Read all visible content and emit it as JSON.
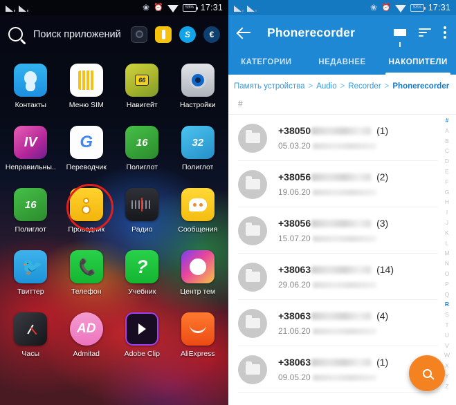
{
  "left_panel": {
    "status_bar": {
      "signal_1": "signal-bars-icon",
      "signal_2": "signal-bars-icon",
      "bluetooth": "bluetooth-icon",
      "alarm": "alarm-clock-icon",
      "wifi": "wifi-icon",
      "battery_label": "53%",
      "time": "17:31"
    },
    "search": {
      "icon": "search-icon",
      "placeholder": "Поиск приложений",
      "quick_apps": [
        {
          "name": "camera-app-icon",
          "label": ""
        },
        {
          "name": "yellow-app-icon",
          "label": ""
        },
        {
          "name": "skype-app-icon",
          "label": "S"
        },
        {
          "name": "euro-app-icon",
          "label": "€"
        }
      ]
    },
    "apps": [
      {
        "label": "Контакты",
        "icon": "contacts-icon",
        "cls": "ic-contacts",
        "glyph": ""
      },
      {
        "label": "Меню SIM",
        "icon": "sim-menu-icon",
        "cls": "ic-sim",
        "glyph": ""
      },
      {
        "label": "Навигейт",
        "icon": "navigate-icon",
        "cls": "ic-nav",
        "glyph": "66"
      },
      {
        "label": "Настройки",
        "icon": "settings-icon",
        "cls": "ic-settings",
        "glyph": ""
      },
      {
        "label": "Неправильны..",
        "icon": "irregular-verbs-icon",
        "cls": "ic-irreg",
        "glyph": "IV"
      },
      {
        "label": "Переводчик",
        "icon": "translate-icon",
        "cls": "ic-transl",
        "glyph": "G"
      },
      {
        "label": "Полиглот",
        "icon": "polyglot-16-icon",
        "cls": "ic-poly16",
        "glyph": "16"
      },
      {
        "label": "Полиглот",
        "icon": "polyglot-32-icon",
        "cls": "ic-poly32",
        "glyph": "32"
      },
      {
        "label": "Полиглот",
        "icon": "polyglot-16b-icon",
        "cls": "ic-poly16",
        "glyph": "16"
      },
      {
        "label": "Проводник",
        "icon": "file-explorer-icon",
        "cls": "ic-explorer",
        "glyph": ""
      },
      {
        "label": "Радио",
        "icon": "radio-icon",
        "cls": "ic-radio",
        "glyph": ""
      },
      {
        "label": "Сообщения",
        "icon": "messages-icon",
        "cls": "ic-msg",
        "glyph": ""
      },
      {
        "label": "Твиттер",
        "icon": "twitter-icon",
        "cls": "ic-twitter",
        "glyph": "🐦"
      },
      {
        "label": "Телефон",
        "icon": "phone-icon",
        "cls": "ic-phone",
        "glyph": "📞"
      },
      {
        "label": "Учебник",
        "icon": "textbook-icon",
        "cls": "ic-book",
        "glyph": "?"
      },
      {
        "label": "Центр тем",
        "icon": "theme-center-icon",
        "cls": "ic-theme",
        "glyph": ""
      },
      {
        "label": "Часы",
        "icon": "clock-icon",
        "cls": "ic-clock",
        "glyph": ""
      },
      {
        "label": "Admitad",
        "icon": "admitad-icon",
        "cls": "ic-admitad",
        "glyph": "AD"
      },
      {
        "label": "Adobe Clip",
        "icon": "adobe-clip-icon",
        "cls": "ic-adobe",
        "glyph": ""
      },
      {
        "label": "AliExpress",
        "icon": "aliexpress-icon",
        "cls": "ic-ali",
        "glyph": ""
      }
    ],
    "annotation": {
      "name": "red-circle-highlight",
      "target_label": "Проводник",
      "color": "#e0201b"
    }
  },
  "right_panel": {
    "status_bar": {
      "battery_label": "53%",
      "time": "17:31"
    },
    "appbar": {
      "back_icon": "back-arrow-icon",
      "title": "Phonerecorder",
      "filter_icon": "filter-icon",
      "sort_icon": "sort-icon",
      "more_icon": "overflow-menu-icon"
    },
    "tabs": [
      {
        "label": "КАТЕГОРИИ",
        "active": false
      },
      {
        "label": "НЕДАВНЕЕ",
        "active": false
      },
      {
        "label": "НАКОПИТЕЛИ",
        "active": true
      }
    ],
    "breadcrumb": [
      {
        "label": "Память устройства",
        "last": false
      },
      {
        "label": "Audio",
        "last": false
      },
      {
        "label": "Recorder",
        "last": false
      },
      {
        "label": "Phonerecorder",
        "last": true
      }
    ],
    "breadcrumb_separator": ">",
    "column_header": "#",
    "rows": [
      {
        "number": "+38050",
        "count": "(1)",
        "date": "05.03.20",
        "icon": "folder-icon"
      },
      {
        "number": "+38056",
        "count": "(2)",
        "date": "19.06.20",
        "icon": "folder-icon"
      },
      {
        "number": "+38056",
        "count": "(3)",
        "date": "15.07.20",
        "icon": "folder-icon"
      },
      {
        "number": "+38063",
        "count": "(14)",
        "date": "29.06.20",
        "icon": "folder-icon"
      },
      {
        "number": "+38063",
        "count": "(4)",
        "date": "21.06.20",
        "icon": "folder-icon"
      },
      {
        "number": "+38063",
        "count": "(1)",
        "date": "09.05.20",
        "icon": "folder-icon"
      }
    ],
    "alpha_index": {
      "letters": [
        "#",
        "A",
        "B",
        "C",
        "D",
        "E",
        "F",
        "G",
        "H",
        "I",
        "J",
        "K",
        "L",
        "M",
        "N",
        "O",
        "P",
        "Q",
        "R",
        "S",
        "T",
        "U",
        "V",
        "W",
        "X",
        "Y",
        "Z"
      ],
      "highlighted": [
        "#",
        "R"
      ]
    },
    "fab": {
      "icon": "search-icon"
    },
    "colors": {
      "appbar_blue": "#1e88d4",
      "breadcrumb_link": "#2e9ae0",
      "breadcrumb_current": "#1878c4",
      "fab_orange": "#f58220"
    }
  }
}
